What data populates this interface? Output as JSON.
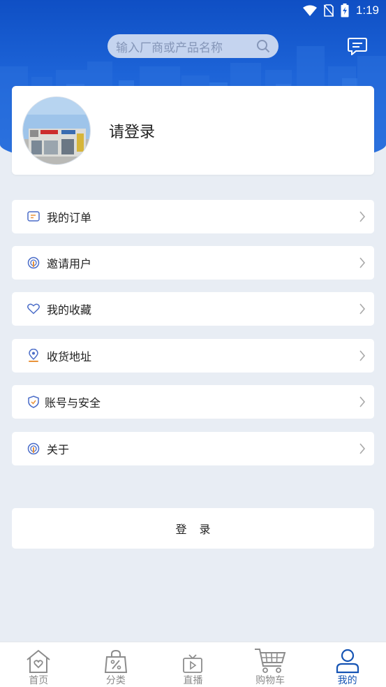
{
  "status_bar": {
    "time": "1:19"
  },
  "search": {
    "placeholder": "输入厂商或产品名称"
  },
  "profile": {
    "login_prompt": "请登录"
  },
  "menu": [
    {
      "label": "我的订单",
      "icon": "order-icon"
    },
    {
      "label": "邀请用户",
      "icon": "invite-icon"
    },
    {
      "label": "我的收藏",
      "icon": "heart-icon"
    },
    {
      "label": "收货地址",
      "icon": "location-pin-icon"
    },
    {
      "label": "账号与安全",
      "icon": "shield-icon"
    },
    {
      "label": "关于",
      "icon": "about-icon"
    }
  ],
  "login_button": {
    "label": "登录"
  },
  "bottom_nav": [
    {
      "label": "首页",
      "icon": "home-heart-icon",
      "active": false
    },
    {
      "label": "分类",
      "icon": "shopping-bag-percent-icon",
      "active": false
    },
    {
      "label": "直播",
      "icon": "tv-play-icon",
      "active": false
    },
    {
      "label": "购物车",
      "icon": "cart-icon",
      "active": false
    },
    {
      "label": "我的",
      "icon": "user-icon",
      "active": true
    }
  ],
  "colors": {
    "header_blue": "#1d64d8",
    "active_tab": "#1554b4",
    "inactive_tab": "#8c8c8c",
    "page_bg": "#e8edf4"
  }
}
